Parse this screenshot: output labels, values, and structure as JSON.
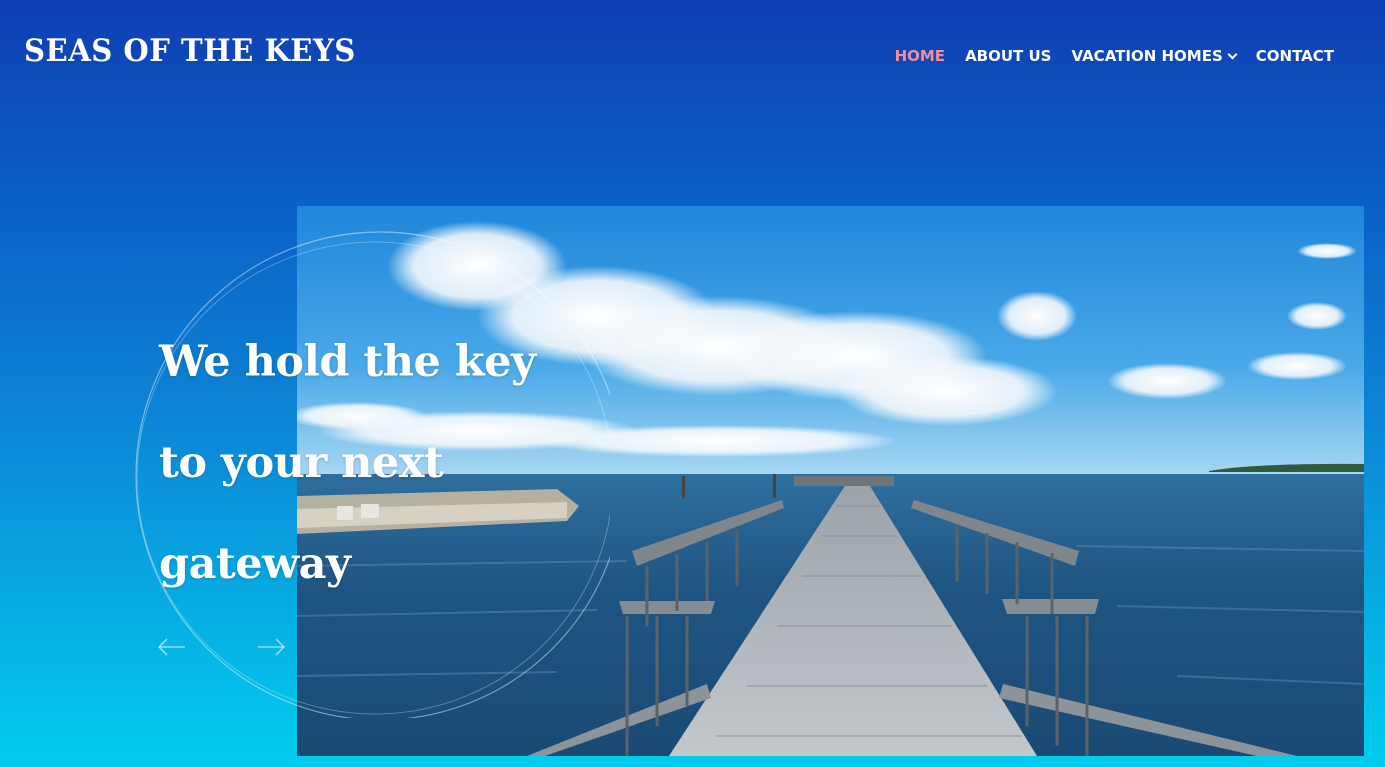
{
  "header": {
    "logo": "SEAS OF THE KEYS",
    "nav": [
      {
        "label": "HOME",
        "active": true
      },
      {
        "label": "ABOUT US",
        "active": false
      },
      {
        "label": "VACATION HOMES",
        "active": false,
        "has_dropdown": true
      },
      {
        "label": "CONTACT",
        "active": false
      }
    ]
  },
  "hero": {
    "headline_lines": [
      "We hold the key",
      "to your next",
      "gateway"
    ],
    "image_subject": "wooden pier extending over open water under a blue sky with clouds"
  },
  "slider": {
    "prev_icon": "arrow-left-icon",
    "next_icon": "arrow-right-icon"
  },
  "colors": {
    "gradient_top": "#0f3eb3",
    "gradient_bottom": "#02cdef",
    "nav_active": "#f38c9c",
    "text": "#ffffff"
  }
}
